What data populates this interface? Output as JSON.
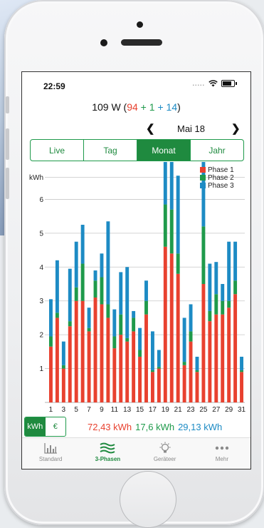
{
  "status_bar": {
    "time": "22:59",
    "signal": "....."
  },
  "header": {
    "power_total": "109 W (",
    "phase1": "94",
    "plus1": " + ",
    "phase2": "1",
    "plus2": " + ",
    "phase3": "14",
    "close": ")"
  },
  "month_nav": {
    "prev_icon": "chevron-left-icon",
    "label": "Mai 18",
    "next_icon": "chevron-right-icon"
  },
  "tabs": [
    {
      "label": "Live",
      "active": false
    },
    {
      "label": "Tag",
      "active": false
    },
    {
      "label": "Monat",
      "active": true
    },
    {
      "label": "Jahr",
      "active": false
    }
  ],
  "chart_data": {
    "type": "bar",
    "stacked": true,
    "ylabel": "kWh",
    "ylim": [
      0,
      7
    ],
    "yticks": [
      1,
      2,
      3,
      4,
      5,
      6
    ],
    "categories": [
      1,
      2,
      3,
      4,
      5,
      6,
      7,
      8,
      9,
      10,
      11,
      12,
      13,
      14,
      15,
      16,
      17,
      18,
      19,
      20,
      21,
      22,
      23,
      24,
      25,
      26,
      27,
      28,
      29,
      30,
      31
    ],
    "xtick_labels": [
      "1",
      "3",
      "5",
      "7",
      "9",
      "11",
      "13",
      "15",
      "17",
      "19",
      "21",
      "23",
      "25",
      "27",
      "29",
      "31"
    ],
    "legend_position": "top-right",
    "series": [
      {
        "name": "Phase 1",
        "color": "#e8412f",
        "values": [
          1.65,
          2.5,
          1.0,
          2.25,
          3.0,
          3.0,
          2.1,
          3.1,
          2.9,
          2.5,
          1.6,
          2.0,
          1.8,
          2.1,
          1.35,
          2.6,
          0.9,
          1.0,
          4.6,
          4.4,
          3.8,
          1.1,
          1.8,
          0.9,
          3.5,
          2.4,
          2.6,
          2.6,
          2.8,
          3.2,
          0.9
        ]
      },
      {
        "name": "Phase 2",
        "color": "#1f9a4b",
        "values": [
          0.3,
          0.15,
          0.1,
          0.15,
          0.4,
          1.1,
          0.1,
          0.5,
          0.8,
          0.4,
          0.35,
          0.6,
          0.1,
          0.4,
          0.2,
          0.4,
          0.05,
          0.05,
          1.25,
          1.3,
          0.6,
          0.1,
          0.3,
          0.05,
          1.7,
          0.3,
          0.6,
          0.4,
          0.2,
          0.4,
          0.05
        ]
      },
      {
        "name": "Phase 3",
        "color": "#1d8bc4",
        "values": [
          1.1,
          1.55,
          0.7,
          1.55,
          1.35,
          1.15,
          0.6,
          0.3,
          0.7,
          2.45,
          0.8,
          1.25,
          2.1,
          0.2,
          0.65,
          0.6,
          1.15,
          0.5,
          2.05,
          1.5,
          2.3,
          1.3,
          0.8,
          0.4,
          2.1,
          1.4,
          0.95,
          0.5,
          1.75,
          1.15,
          0.4
        ]
      }
    ]
  },
  "units": {
    "kwh": "kWh",
    "euro": "€"
  },
  "totals": {
    "phase1": "72,43 kWh",
    "phase2": "17,6 kWh",
    "phase3": "29,13 kWh"
  },
  "tabbar": [
    {
      "label": "Standard",
      "icon": "bar-chart-icon",
      "active": false
    },
    {
      "label": "3-Phasen",
      "icon": "waves-icon",
      "active": true
    },
    {
      "label": "Geräteer",
      "icon": "lightbulb-icon",
      "active": false
    },
    {
      "label": "Mehr",
      "icon": "more-dots-icon",
      "active": false
    }
  ]
}
